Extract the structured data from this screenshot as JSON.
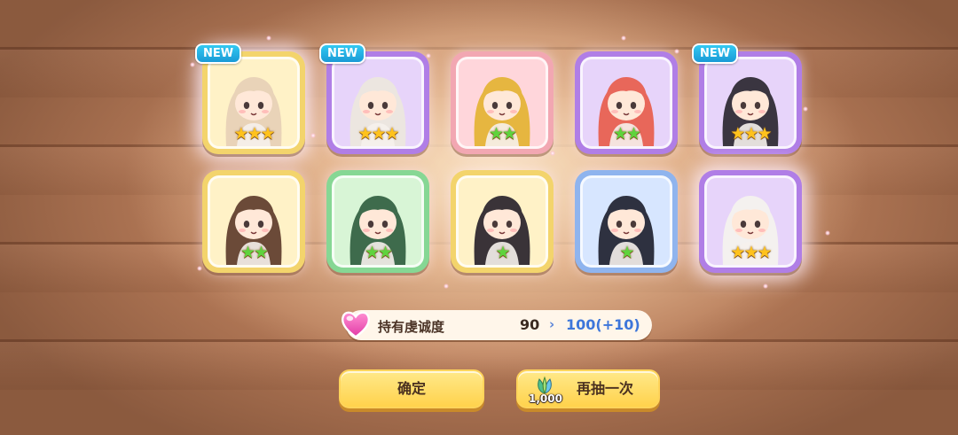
{
  "badge_text": "NEW",
  "cards": [
    {
      "frame": "yellow",
      "stars": 3,
      "star_color": "gold",
      "is_new": true,
      "glow": true,
      "hair": "#e9d3b8"
    },
    {
      "frame": "purple",
      "stars": 3,
      "star_color": "gold",
      "is_new": true,
      "glow": false,
      "hair": "#ece6e0"
    },
    {
      "frame": "pink",
      "stars": 2,
      "star_color": "green",
      "is_new": false,
      "glow": false,
      "hair": "#e6b640"
    },
    {
      "frame": "purple",
      "stars": 2,
      "star_color": "green",
      "is_new": false,
      "glow": false,
      "hair": "#e8675a"
    },
    {
      "frame": "purple",
      "stars": 3,
      "star_color": "gold",
      "is_new": true,
      "glow": false,
      "hair": "#3a3540"
    },
    {
      "frame": "yellow",
      "stars": 2,
      "star_color": "green",
      "is_new": false,
      "glow": false,
      "hair": "#6b4a38"
    },
    {
      "frame": "green",
      "stars": 2,
      "star_color": "green",
      "is_new": false,
      "glow": false,
      "hair": "#3e6b4c"
    },
    {
      "frame": "yellow",
      "stars": 1,
      "star_color": "green",
      "is_new": false,
      "glow": false,
      "hair": "#3a3338"
    },
    {
      "frame": "blue",
      "stars": 1,
      "star_color": "green",
      "is_new": false,
      "glow": false,
      "hair": "#2e3140"
    },
    {
      "frame": "purple",
      "stars": 3,
      "star_color": "gold",
      "is_new": false,
      "glow": true,
      "hair": "#f4f1ef"
    }
  ],
  "info": {
    "label": "持有虔诚度",
    "current": "90",
    "arrow": "›",
    "next": "100(+10)"
  },
  "buttons": {
    "confirm": "确定",
    "redraw": "再抽一次",
    "redraw_cost": "1,000"
  },
  "icons": {
    "heart": "heart-icon",
    "cost": "leaf-currency-icon"
  },
  "colors": {
    "badge": "#1fa8e0",
    "next_value": "#3d76da",
    "button": "#ffd24c"
  }
}
